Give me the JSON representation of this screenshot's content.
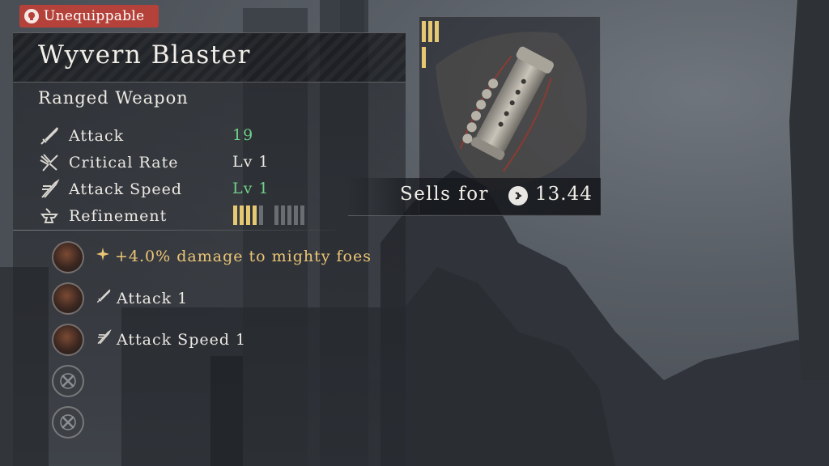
{
  "badge": {
    "label": "Unequippable",
    "icon": "unequippable-head-icon",
    "color": "#b5423a"
  },
  "item": {
    "name": "Wyvern Blaster",
    "type": "Ranged Weapon",
    "tier_marks": 4
  },
  "stats": [
    {
      "icon": "sword-icon",
      "label": "Attack",
      "value": "19",
      "color": "#6fd08a"
    },
    {
      "icon": "critical-burst-icon",
      "label": "Critical Rate",
      "value": "Lv 1",
      "color": "#ece9e3"
    },
    {
      "icon": "speed-blade-icon",
      "label": "Attack Speed",
      "value": "Lv 1",
      "color": "#6fd08a"
    },
    {
      "icon": "anvil-icon",
      "label": "Refinement",
      "value": "",
      "color": "#ece9e3"
    }
  ],
  "refinement": {
    "level": 4,
    "max": 10
  },
  "slots": [
    {
      "state": "filled",
      "icon": "spark-icon",
      "text": "+4.0% damage to mighty foes",
      "color": "#ecc575"
    },
    {
      "state": "filled",
      "icon": "sword-icon",
      "text": "Attack 1",
      "color": "#ece9e3"
    },
    {
      "state": "filled",
      "icon": "speed-blade-icon",
      "text": "Attack Speed 1",
      "color": "#ece9e3"
    },
    {
      "state": "empty",
      "icon": "",
      "text": "",
      "color": ""
    },
    {
      "state": "empty",
      "icon": "",
      "text": "",
      "color": ""
    }
  ],
  "sell": {
    "label": "Sells for",
    "value": "13.44",
    "icon": "currency-coin-icon"
  }
}
